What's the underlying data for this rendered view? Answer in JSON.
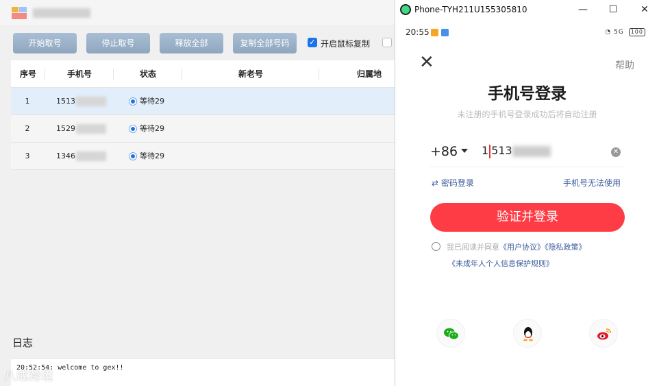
{
  "app": {
    "toolbar": {
      "start": "开始取号",
      "stop": "停止取号",
      "release": "释放全部",
      "copy": "复制全部号码",
      "mouse_copy": "开启鼠标复制"
    },
    "table": {
      "headers": [
        "序号",
        "手机号",
        "状态",
        "新老号",
        "归属地"
      ],
      "rows": [
        {
          "idx": "1",
          "phone": "1513",
          "status": "等待29"
        },
        {
          "idx": "2",
          "phone": "1529",
          "status": "等待29"
        },
        {
          "idx": "3",
          "phone": "1346",
          "status": "等待29"
        }
      ]
    },
    "log": {
      "title": "日志",
      "lines": [
        "20:52:54: welcome to gex!!"
      ]
    },
    "watermark": "八戒跨境"
  },
  "phone": {
    "window_title": "Phone-TYH211U155305810",
    "status_time": "20:55",
    "status_right": "5G",
    "battery": "100",
    "help": "帮助",
    "title": "手机号登录",
    "subtitle": "未注册的手机号登录成功后将自动注册",
    "country_code": "+86",
    "phone_prefix": "1",
    "phone_mid": "513",
    "password_login": "⇄ 密码登录",
    "cannot_use": "手机号无法使用",
    "login_button": "验证并登录",
    "agree_prefix": "我已阅读并同意",
    "user_agreement": "《用户协议》",
    "privacy_policy": "《隐私政策》",
    "minor_policy": "《未成年人个人信息保护规则》",
    "colors": {
      "primary": "#fd3c45",
      "link": "#3b5b9b"
    }
  }
}
